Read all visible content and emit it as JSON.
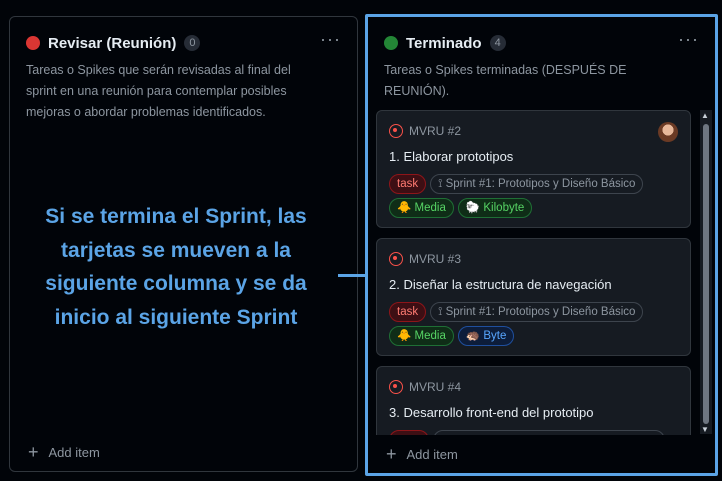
{
  "columns": {
    "left": {
      "title": "Revisar (Reunión)",
      "count": "0",
      "dot_color": "#da3633",
      "desc_lines": [
        "Tareas o Spikes que serán revisadas al final del",
        "sprint en una reunión para contemplar posibles",
        "mejoras o abordar problemas identificados."
      ],
      "add_item": "Add item",
      "more": "···"
    },
    "right": {
      "title": "Terminado",
      "count": "4",
      "dot_color": "#238636",
      "desc_lines": [
        "Tareas o Spikes terminadas (DESPUÉS DE",
        "REUNIÓN)."
      ],
      "add_item": "Add item",
      "more": "···"
    }
  },
  "cards": [
    {
      "id": "MVRU #2",
      "title": "1. Elaborar prototipos",
      "labels_row1": [
        "task",
        "Sprint #1: Prototipos y Diseño Básico"
      ],
      "labels_row2": [
        "Media",
        "Kilobyte"
      ],
      "has_avatar": true
    },
    {
      "id": "MVRU #3",
      "title": "2. Diseñar la estructura de navegación",
      "labels_row1": [
        "task",
        "Sprint #1: Prototipos y Diseño Básico"
      ],
      "labels_row2": [
        "Media",
        "Byte"
      ]
    },
    {
      "id": "MVRU #4",
      "title": "3. Desarrollo front-end del prototipo"
    }
  ],
  "annotation": {
    "lines": [
      "Si se termina el Sprint, las",
      "tarjetas se mueven a la",
      "siguiente columna y se da",
      "inicio al siguiente Sprint"
    ],
    "color": "#5ba4e6"
  },
  "icons": {
    "sprint_icon": "⟟",
    "media_icon": "🐥",
    "kilobyte_icon": "🐑",
    "byte_icon": "🦔"
  }
}
